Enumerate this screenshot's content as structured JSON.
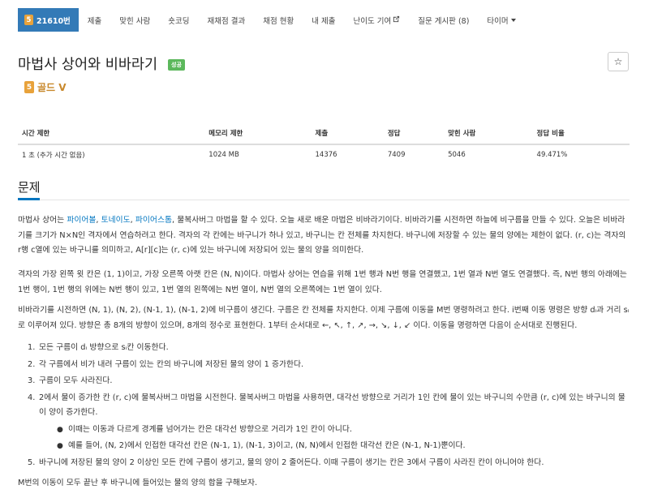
{
  "nav": {
    "problem_number": "21610번",
    "tier_digit": "5",
    "items": [
      "제출",
      "맞힌 사람",
      "숏코딩",
      "재채점 결과",
      "채점 현황",
      "내 제출",
      "난이도 기여",
      "질문 게시판 (8)",
      "타이머"
    ]
  },
  "problem": {
    "title": "마법사 상어와 비바라기",
    "status": "성공",
    "star": "☆",
    "tier_label": "골드 V"
  },
  "info_table": {
    "headers": [
      "시간 제한",
      "메모리 제한",
      "제출",
      "정답",
      "맞힌 사람",
      "정답 비율"
    ],
    "row": [
      "1 초 (추가 시간 없음)",
      "1024 MB",
      "14376",
      "7409",
      "5046",
      "49.471%"
    ]
  },
  "section": {
    "title": "문제"
  },
  "text": {
    "p1_a": "마법사 상어는 ",
    "p1_links": [
      "파이어볼",
      "토네이도",
      "파이어스톰"
    ],
    "p1_sep": ", ",
    "p1_b": ", 물복사버그 마법을 할 수 있다. 오늘 새로 배운 마법은 비바라기이다. 비바라기를 시전하면 하늘에 비구름을 만들 수 있다. 오늘은 비바라기를 크기가 N×N인 격자에서 연습하려고 한다. 격자의 각 칸에는 바구니가 하나 있고, 바구니는 칸 전체를 차지한다. 바구니에 저장할 수 있는 물의 양에는 제한이 없다. (r, c)는 격자의 r행 c열에 있는 바구니를 의미하고, A[r][c]는 (r, c)에 있는 바구니에 저장되어 있는 물의 양을 의미한다.",
    "p2": "격자의 가장 왼쪽 윗 칸은 (1, 1)이고, 가장 오른쪽 아랫 칸은 (N, N)이다. 마법사 상어는 연습을 위해 1번 행과 N번 행을 연결했고, 1번 열과 N번 열도 연결했다. 즉, N번 행의 아래에는 1번 행이, 1번 행의 위에는 N번 행이 있고, 1번 열의 왼쪽에는 N번 열이, N번 열의 오른쪽에는 1번 열이 있다.",
    "p3": "비바라기를 시전하면 (N, 1), (N, 2), (N-1, 1), (N-1, 2)에 비구름이 생긴다. 구름은 칸 전체를 차지한다. 이제 구름에 이동을 M번 명령하려고 한다. i번째 이동 명령은 방향 dᵢ과 거리 sᵢ로 이루어져 있다. 방향은 총 8개의 방향이 있으며, 8개의 정수로 표현한다. 1부터 순서대로 ←, ↖, ↑, ↗, →, ↘, ↓, ↙ 이다. 이동을 명령하면 다음이 순서대로 진행된다.",
    "steps": [
      "모든 구름이 dᵢ 방향으로 sᵢ칸 이동한다.",
      "각 구름에서 비가 내려 구름이 있는 칸의 바구니에 저장된 물의 양이 1 증가한다.",
      "구름이 모두 사라진다.",
      "2에서 물이 증가한 칸 (r, c)에 물복사버그 마법을 시전한다. 물복사버그 마법을 사용하면, 대각선 방향으로 거리가 1인 칸에 물이 있는 바구니의 수만큼 (r, c)에 있는 바구니의 물이 양이 증가한다.",
      "바구니에 저장된 물의 양이 2 이상인 모든 칸에 구름이 생기고, 물의 양이 2 줄어든다. 이때 구름이 생기는 칸은 3에서 구름이 사라진 칸이 아니어야 한다."
    ],
    "sub_steps": [
      "이때는 이동과 다르게 경계를 넘어가는 칸은 대각선 방향으로 거리가 1인 칸이 아니다.",
      "예를 들어, (N, 2)에서 인접한 대각선 칸은 (N-1, 1), (N-1, 3)이고, (N, N)에서 인접한 대각선 칸은 (N-1, N-1)뿐이다."
    ],
    "step_numbers": [
      "1.",
      "2.",
      "3.",
      "4.",
      "5."
    ],
    "p4": "M번의 이동이 모두 끝난 후 바구니에 들어있는 물의 양의 합을 구해보자."
  },
  "colors": {
    "nav_active": "#337ab7",
    "tier": "#e8a23b",
    "status": "#5cb85c",
    "link": "#0076c0"
  }
}
